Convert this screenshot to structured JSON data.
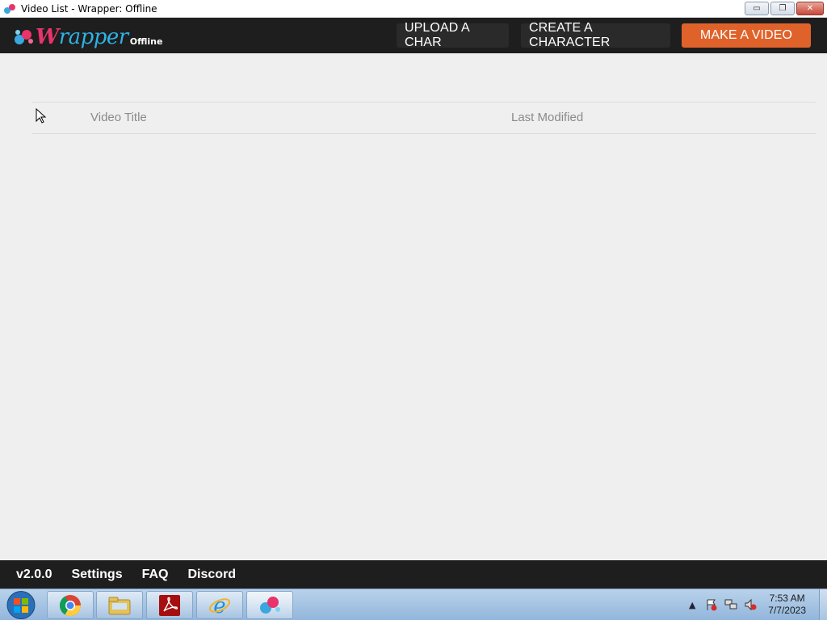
{
  "window": {
    "title": "Video List - Wrapper: Offline",
    "minimize_label": "▭",
    "restore_label": "❐",
    "close_label": "✕"
  },
  "header": {
    "logo_word": "rapper",
    "logo_initial": "W",
    "logo_sub": "Offline",
    "upload_label": "UPLOAD A CHAR",
    "create_label": "CREATE A CHARACTER",
    "make_label": "MAKE A VIDEO"
  },
  "list": {
    "columns": [
      "Video Title",
      "Last Modified"
    ]
  },
  "footer": {
    "version": "v2.0.0",
    "links": [
      "Settings",
      "FAQ",
      "Discord"
    ]
  },
  "taskbar": {
    "apps": [
      "chrome-icon",
      "file-explorer-icon",
      "acrobat-icon",
      "internet-explorer-icon",
      "wrapper-icon"
    ],
    "time": "7:53 AM",
    "date": "7/7/2023"
  },
  "colors": {
    "accent": "#e0622b",
    "header_bg": "#1e1e1e",
    "page_bg": "#efefef"
  }
}
